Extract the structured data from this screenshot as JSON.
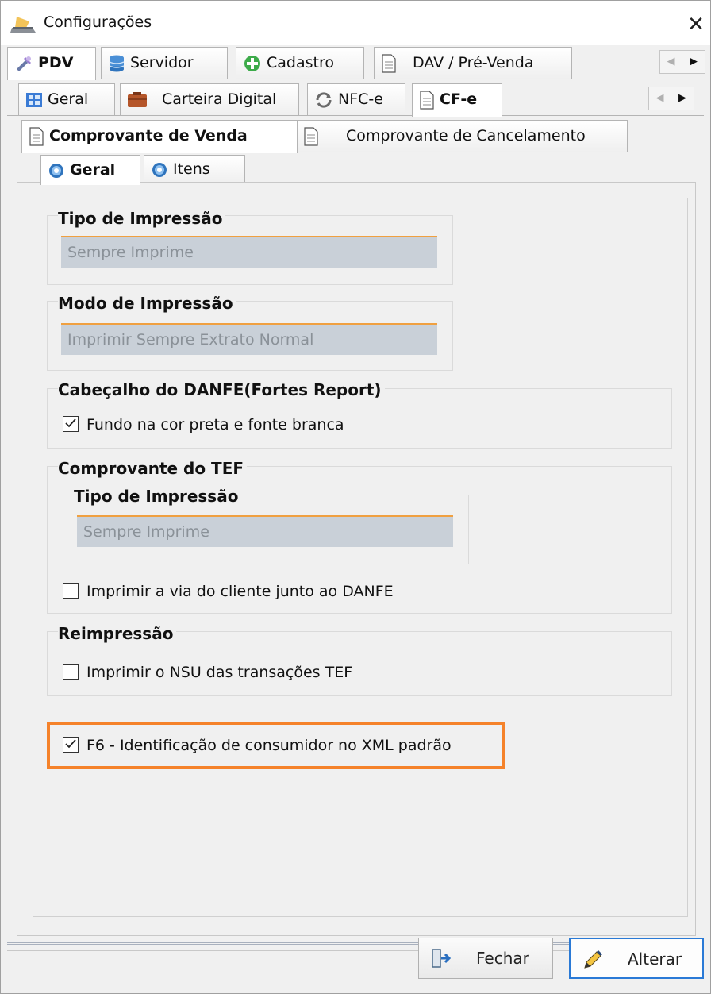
{
  "window": {
    "title": "Configurações",
    "close_glyph": "✕"
  },
  "tabs_level1": [
    {
      "label": "PDV",
      "icon": "tools-icon",
      "active": true
    },
    {
      "label": "Servidor",
      "icon": "database-icon"
    },
    {
      "label": "Cadastro",
      "icon": "add-circle-icon"
    },
    {
      "label": "DAV / Pré-Venda",
      "icon": "document-icon"
    }
  ],
  "tabs_level2": [
    {
      "label": "Geral",
      "icon": "grid-icon"
    },
    {
      "label": "Carteira Digital",
      "icon": "wallet-icon"
    },
    {
      "label": "NFC-e",
      "icon": "refresh-icon"
    },
    {
      "label": "CF-e",
      "icon": "document-icon",
      "active": true
    }
  ],
  "tabs_level3": [
    {
      "label": "Comprovante de Venda",
      "icon": "document-icon",
      "active": true
    },
    {
      "label": "Comprovante de Cancelamento",
      "icon": "document-icon"
    }
  ],
  "tabs_level4": [
    {
      "label": "Geral",
      "icon": "gear-icon",
      "active": true
    },
    {
      "label": "Itens",
      "icon": "gear-icon"
    }
  ],
  "content": {
    "tipo_impressao": {
      "title": "Tipo de Impressão",
      "value": "Sempre Imprime"
    },
    "modo_impressao": {
      "title": "Modo de Impressão",
      "value": "Imprimir Sempre Extrato Normal"
    },
    "cabecalho": {
      "title": "Cabeçalho do DANFE(Fortes Report)",
      "checkbox_label": "Fundo na cor preta e fonte branca",
      "checked": true
    },
    "comprovante_tef": {
      "title": "Comprovante do TEF",
      "tipo_title": "Tipo de Impressão",
      "tipo_value": "Sempre Imprime",
      "checkbox_label": "Imprimir a via do cliente junto ao DANFE",
      "checked": false
    },
    "reimpressao": {
      "title": "Reimpressão",
      "checkbox_label": "Imprimir o NSU das transações TEF",
      "checked": false
    },
    "f6": {
      "checkbox_label": "F6 - Identificação de consumidor no XML padrão",
      "checked": true
    }
  },
  "buttons": {
    "fechar": "Fechar",
    "alterar": "Alterar"
  },
  "colors": {
    "highlight": "#f5822a",
    "combo_accent": "#f0a040",
    "primary_border": "#2a7ad6"
  }
}
